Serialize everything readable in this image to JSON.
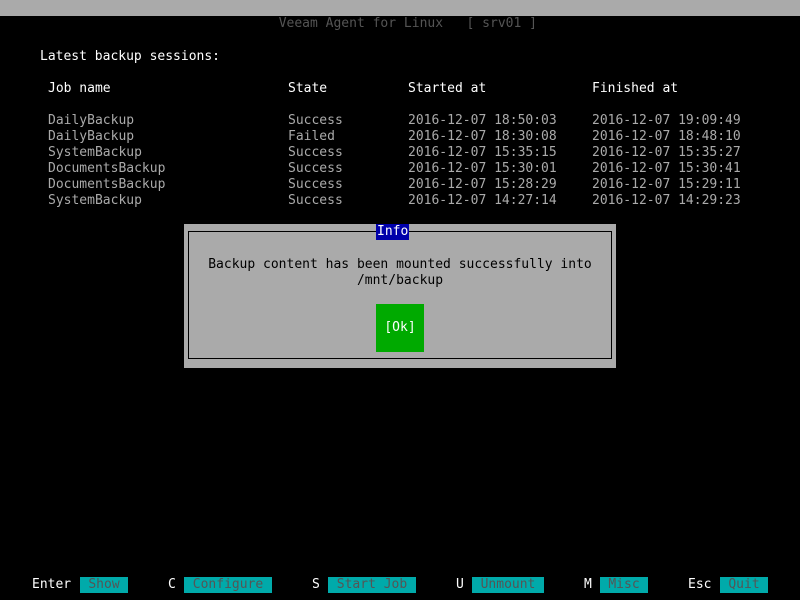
{
  "window": {
    "title": "Veeam Agent for Linux   [ srv01 ]"
  },
  "sessions": {
    "heading": "Latest backup sessions:",
    "columns": [
      "Job name",
      "State",
      "Started at",
      "Finished at"
    ],
    "rows": [
      {
        "job": "DailyBackup",
        "state": "Success",
        "started": "2016-12-07 18:50:03",
        "finished": "2016-12-07 19:09:49"
      },
      {
        "job": "DailyBackup",
        "state": "Failed",
        "started": "2016-12-07 18:30:08",
        "finished": "2016-12-07 18:48:10"
      },
      {
        "job": "SystemBackup",
        "state": "Success",
        "started": "2016-12-07 15:35:15",
        "finished": "2016-12-07 15:35:27"
      },
      {
        "job": "DocumentsBackup",
        "state": "Success",
        "started": "2016-12-07 15:30:01",
        "finished": "2016-12-07 15:30:41"
      },
      {
        "job": "DocumentsBackup",
        "state": "Success",
        "started": "2016-12-07 15:28:29",
        "finished": "2016-12-07 15:29:11"
      },
      {
        "job": "SystemBackup",
        "state": "Success",
        "started": "2016-12-07 14:27:14",
        "finished": "2016-12-07 14:29:23"
      }
    ]
  },
  "dialog": {
    "title": "Info",
    "message_line1": "Backup content has been mounted successfully into",
    "message_line2": "/mnt/backup",
    "ok_label": "[Ok]"
  },
  "keybar": {
    "items": [
      {
        "key": "Enter",
        "action": "Show"
      },
      {
        "key": "C",
        "action": "Configure"
      },
      {
        "key": "S",
        "action": "Start Job"
      },
      {
        "key": "U",
        "action": "Unmount"
      },
      {
        "key": "M",
        "action": "Misc"
      },
      {
        "key": "Esc",
        "action": "Quit"
      }
    ]
  },
  "colors": {
    "background": "#000000",
    "dialog_bg": "#aaaaaa",
    "dialog_title_bg": "#0000aa",
    "ok_button_bg": "#00aa00",
    "key_action_bg": "#00aaaa"
  }
}
